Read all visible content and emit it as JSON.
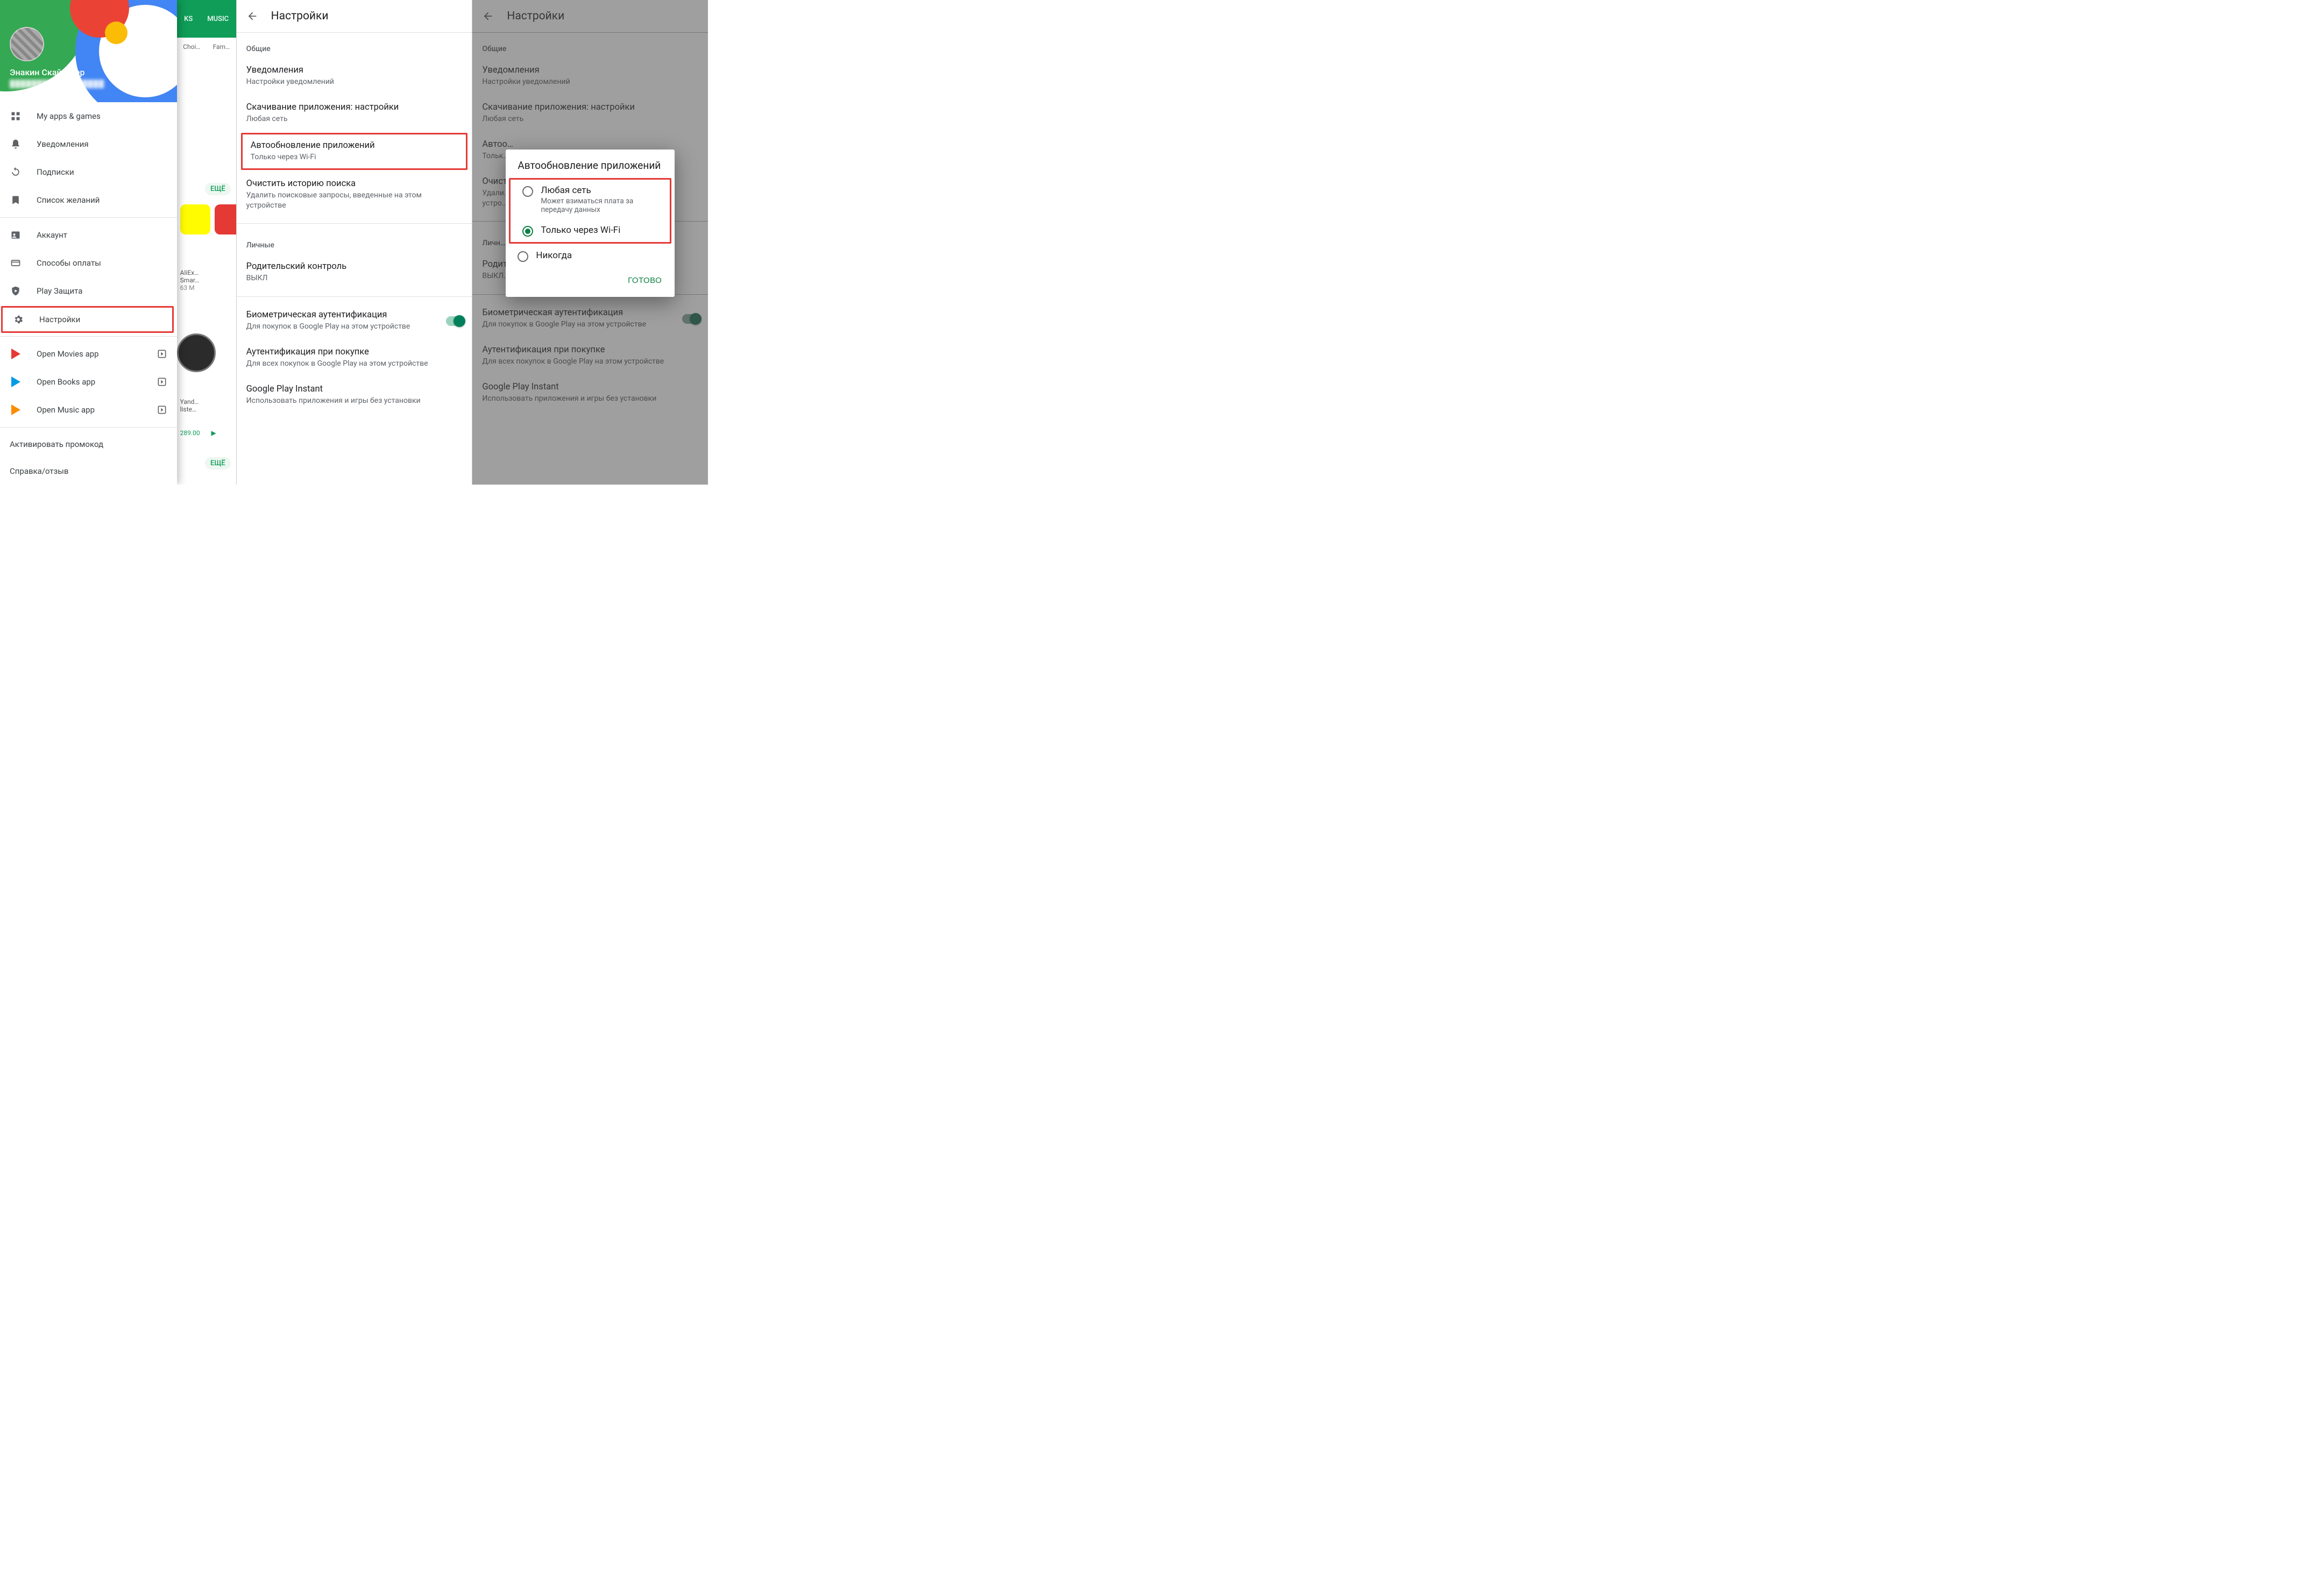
{
  "drawer": {
    "user_name": "Энакин Скайуокер",
    "user_email": "████████@████████",
    "items": [
      {
        "label": "My apps & games"
      },
      {
        "label": "Уведомления"
      },
      {
        "label": "Подписки"
      },
      {
        "label": "Список желаний"
      },
      {
        "label": "Аккаунт"
      },
      {
        "label": "Способы оплаты"
      },
      {
        "label": "Play Защита"
      },
      {
        "label": "Настройки"
      },
      {
        "label": "Open Movies app"
      },
      {
        "label": "Open Books app"
      },
      {
        "label": "Open Music app"
      }
    ],
    "footer": {
      "promo": "Активировать промокод",
      "help": "Справка/отзыв"
    }
  },
  "store": {
    "tab1": "KS",
    "tab2": "MUSIC",
    "chip1": "Choi…",
    "chip2": "Fam…",
    "more": "ЕЩЁ",
    "app1_name": "AliEx…",
    "app1_sub": "Smar…",
    "app1_meta": "63 M",
    "app2_name": "Yand…",
    "app2_sub": "liste…",
    "app2_price": "289.00"
  },
  "settings": {
    "title": "Настройки",
    "section_general": "Общие",
    "section_personal": "Личные",
    "items": {
      "notifications": {
        "t": "Уведомления",
        "s": "Настройки уведомлений"
      },
      "download": {
        "t": "Скачивание приложения: настройки",
        "s": "Любая сеть"
      },
      "autoupdate": {
        "t": "Автообновление приложений",
        "s": "Только через Wi-Fi"
      },
      "clear": {
        "t": "Очистить историю поиска",
        "s": "Удалить поисковые запросы, введенные на этом устройстве"
      },
      "parental": {
        "t": "Родительский контроль",
        "s": "ВЫКЛ"
      },
      "biometric": {
        "t": "Биометрическая аутентификация",
        "s": "Для покупок в Google Play на этом устройстве"
      },
      "auth": {
        "t": "Аутентификация при покупке",
        "s": "Для всех покупок в Google Play на этом устройстве"
      },
      "instant": {
        "t": "Google Play Instant",
        "s": "Использовать приложения и игры без установки"
      }
    },
    "bg_items": {
      "autoupdate_t": "Автоо…",
      "autoupdate_s": "Тольк…",
      "clear_t": "Очист…",
      "clear_s": "Удали…",
      "clear_s2": "устро…",
      "personal": "Личн…",
      "parental_t": "Родит…",
      "parental_s": "ВЫКЛ…"
    }
  },
  "dialog": {
    "title": "Автообновление приложений",
    "opt_any": {
      "label": "Любая сеть",
      "sub": "Может взиматься плата за передачу данных"
    },
    "opt_wifi": {
      "label": "Только через Wi-Fi"
    },
    "opt_never": {
      "label": "Никогда"
    },
    "done": "ГОТОВО"
  }
}
